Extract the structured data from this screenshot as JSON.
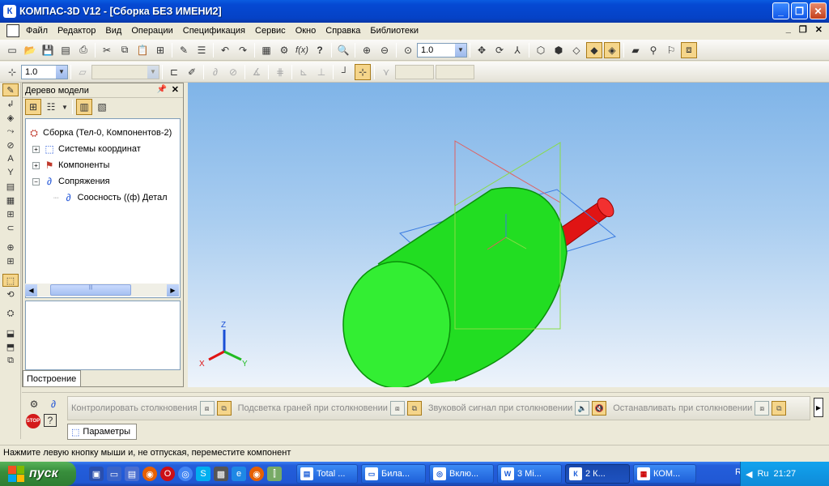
{
  "window": {
    "title": "КОМПАС-3D V12 - [Сборка БЕЗ ИМЕНИ2]",
    "app_icon": "К"
  },
  "menu": {
    "items": [
      "Файл",
      "Редактор",
      "Вид",
      "Операции",
      "Спецификация",
      "Сервис",
      "Окно",
      "Справка",
      "Библиотеки"
    ]
  },
  "toolbar": {
    "scale_value": "1.0",
    "zoom_value": "1.0",
    "fx_label": "f(x)",
    "help_label": "?"
  },
  "tree": {
    "title": "Дерево модели",
    "root": "Сборка (Тел-0, Компонентов-2)",
    "nodes": [
      "Системы координат",
      "Компоненты",
      "Сопряжения"
    ],
    "child": "Соосность ((ф) Детал",
    "tab": "Построение"
  },
  "collision": {
    "options": [
      "Контролировать столкновения",
      "Подсветка граней при столкновении",
      "Звуковой сигнал при столкновении",
      "Останавливать при столкновении"
    ],
    "tab": "Параметры",
    "stop_label": "STOP"
  },
  "axes": {
    "x": "X",
    "y": "Y",
    "z": "Z"
  },
  "status": {
    "text": "Нажмите левую кнопку мыши и, не отпуская, переместите компонент"
  },
  "taskbar": {
    "start": "пуск",
    "tasks": [
      "Total ...",
      "Била...",
      "Вклю...",
      "3 Mi...",
      "2 К...",
      "КОМ..."
    ],
    "lang": "RU",
    "tray_lang": "Ru",
    "clock": "21:27"
  },
  "colors": {
    "part_main": "#22dd22",
    "part_shaft": "#e01414",
    "viewport_top": "#7fb4e8"
  }
}
